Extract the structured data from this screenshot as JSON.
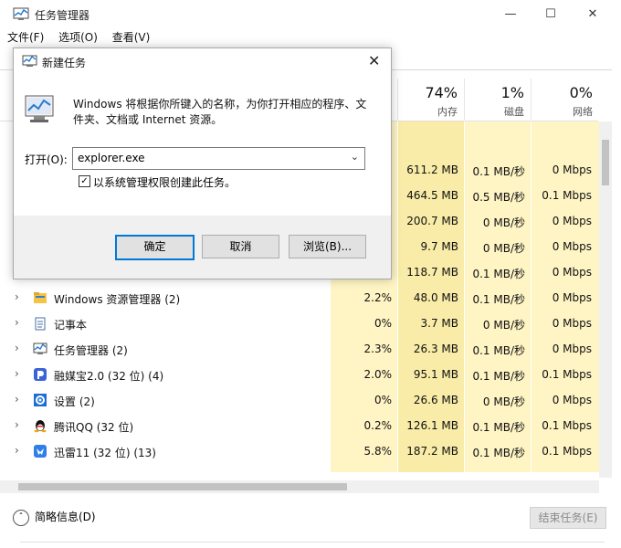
{
  "window": {
    "title": "任务管理器",
    "minimize": "—",
    "maximize": "☐",
    "close": "✕"
  },
  "menu": [
    "文件(F)",
    "选项(O)",
    "查看(V)"
  ],
  "columns": {
    "memory": {
      "pct": "74%",
      "label": "内存"
    },
    "disk": {
      "pct": "1%",
      "label": "磁盘"
    },
    "network": {
      "pct": "0%",
      "label": "网络"
    }
  },
  "hidden_rows": [
    {
      "mem": "611.2 MB",
      "disk": "0.1 MB/秒",
      "net": "0 Mbps"
    },
    {
      "mem": "464.5 MB",
      "disk": "0.5 MB/秒",
      "net": "0.1 Mbps"
    },
    {
      "mem": "200.7 MB",
      "disk": "0 MB/秒",
      "net": "0 Mbps"
    },
    {
      "mem": "9.7 MB",
      "disk": "0 MB/秒",
      "net": "0 Mbps"
    },
    {
      "mem": "118.7 MB",
      "disk": "0.1 MB/秒",
      "net": "0 Mbps"
    }
  ],
  "processes": [
    {
      "name": "Windows 资源管理器 (2)",
      "icon": "folder-icon",
      "cpu": "2.2%",
      "mem": "48.0 MB",
      "disk": "0.1 MB/秒",
      "net": "0 Mbps"
    },
    {
      "name": "记事本",
      "icon": "notepad-icon",
      "cpu": "0%",
      "mem": "3.7 MB",
      "disk": "0 MB/秒",
      "net": "0 Mbps"
    },
    {
      "name": "任务管理器 (2)",
      "icon": "task-manager-icon",
      "cpu": "2.3%",
      "mem": "26.3 MB",
      "disk": "0.1 MB/秒",
      "net": "0 Mbps"
    },
    {
      "name": "融媒宝2.0 (32 位) (4)",
      "icon": "rongmeibao-icon",
      "cpu": "2.0%",
      "mem": "95.1 MB",
      "disk": "0.1 MB/秒",
      "net": "0.1 Mbps"
    },
    {
      "name": "设置 (2)",
      "icon": "gear-icon",
      "cpu": "0%",
      "mem": "26.6 MB",
      "disk": "0 MB/秒",
      "net": "0 Mbps"
    },
    {
      "name": "腾讯QQ (32 位)",
      "icon": "qq-icon",
      "cpu": "0.2%",
      "mem": "126.1 MB",
      "disk": "0.1 MB/秒",
      "net": "0.1 Mbps"
    },
    {
      "name": "迅雷11 (32 位) (13)",
      "icon": "xunlei-icon",
      "cpu": "5.8%",
      "mem": "187.2 MB",
      "disk": "0.1 MB/秒",
      "net": "0.1 Mbps"
    }
  ],
  "footer": {
    "fewer_details": "简略信息(D)",
    "end_task": "结束任务(E)"
  },
  "dialog": {
    "title": "新建任务",
    "description": "Windows 将根据你所键入的名称，为你打开相应的程序、文件夹、文档或 Internet 资源。",
    "open_label": "打开(O):",
    "open_value": "explorer.exe",
    "admin_checkbox_label": "以系统管理权限创建此任务。",
    "admin_checked": true,
    "ok": "确定",
    "cancel": "取消",
    "browse": "浏览(B)..."
  },
  "colors": {
    "cpu_bg": "#fff4c4",
    "mem_bg": "#f9eca8",
    "disk_bg": "#fff4c4",
    "net_bg": "#fff4c4",
    "accent": "#0078d7"
  }
}
